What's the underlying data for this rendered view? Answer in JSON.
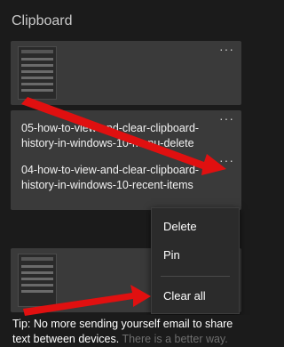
{
  "panel": {
    "title": "Clipboard"
  },
  "items": [
    {
      "type": "image",
      "more": "···"
    },
    {
      "type": "text",
      "text": "05-how-to-view-and-clear-clipboard-history-in-windows-10-menu-delete",
      "more": "···"
    },
    {
      "type": "text",
      "text": "04-how-to-view-and-clear-clipboard-history-in-windows-10-recent-items",
      "more": "···"
    },
    {
      "type": "image",
      "more": "···"
    }
  ],
  "context_menu": {
    "delete": "Delete",
    "pin": "Pin",
    "clear_all": "Clear all"
  },
  "tip": {
    "text": "Tip: No more sending yourself email to share text between devices.",
    "link": "There is a better way."
  },
  "annotation": {
    "arrow_color": "#e01010"
  }
}
